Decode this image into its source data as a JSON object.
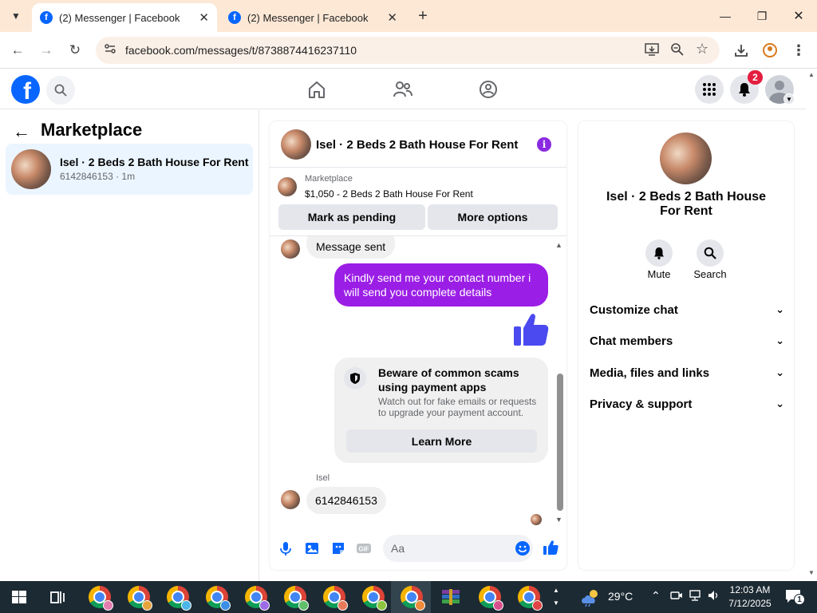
{
  "browser": {
    "tabs": [
      {
        "title": "(2) Messenger | Facebook",
        "active": true
      },
      {
        "title": "(2) Messenger | Facebook",
        "active": false
      }
    ],
    "url": "facebook.com/messages/t/8738874416237110"
  },
  "fb_nav": {
    "notification_count": "2"
  },
  "left_panel": {
    "title": "Marketplace",
    "conversations": [
      {
        "name": "Isel · 2 Beds 2 Bath House For Rent",
        "subtitle": "6142846153 · 1m"
      }
    ]
  },
  "conversation": {
    "title": "Isel · 2 Beds 2 Bath House For Rent",
    "marketplace_label": "Marketplace",
    "listing": "$1,050 - 2 Beds 2 Bath House For Rent",
    "buttons": {
      "pending": "Mark as pending",
      "more": "More options"
    },
    "messages": {
      "sent_status": "Message sent",
      "outgoing": "Kindly send me your contact number i will send you complete details",
      "incoming_sender": "Isel",
      "incoming": "6142846153"
    },
    "scam_warning": {
      "title": "Beware of common scams using payment apps",
      "body": "Watch out for fake emails or requests to upgrade your payment account.",
      "button": "Learn More"
    },
    "composer_placeholder": "Aa"
  },
  "right_panel": {
    "name": "Isel · 2 Beds 2 Bath House For Rent",
    "actions": [
      {
        "label": "Mute"
      },
      {
        "label": "Search"
      }
    ],
    "sections": [
      {
        "label": "Customize chat"
      },
      {
        "label": "Chat members"
      },
      {
        "label": "Media, files and links"
      },
      {
        "label": "Privacy & support"
      }
    ]
  },
  "taskbar": {
    "weather": "29°C",
    "time": "12:03 AM",
    "date": "7/12/2025",
    "notification_count": "1"
  },
  "colors": {
    "facebook_blue": "#0866ff",
    "messenger_purple": "#9b1ee6",
    "like_blue": "#4a4af0",
    "badge_red": "#e41e3f"
  }
}
